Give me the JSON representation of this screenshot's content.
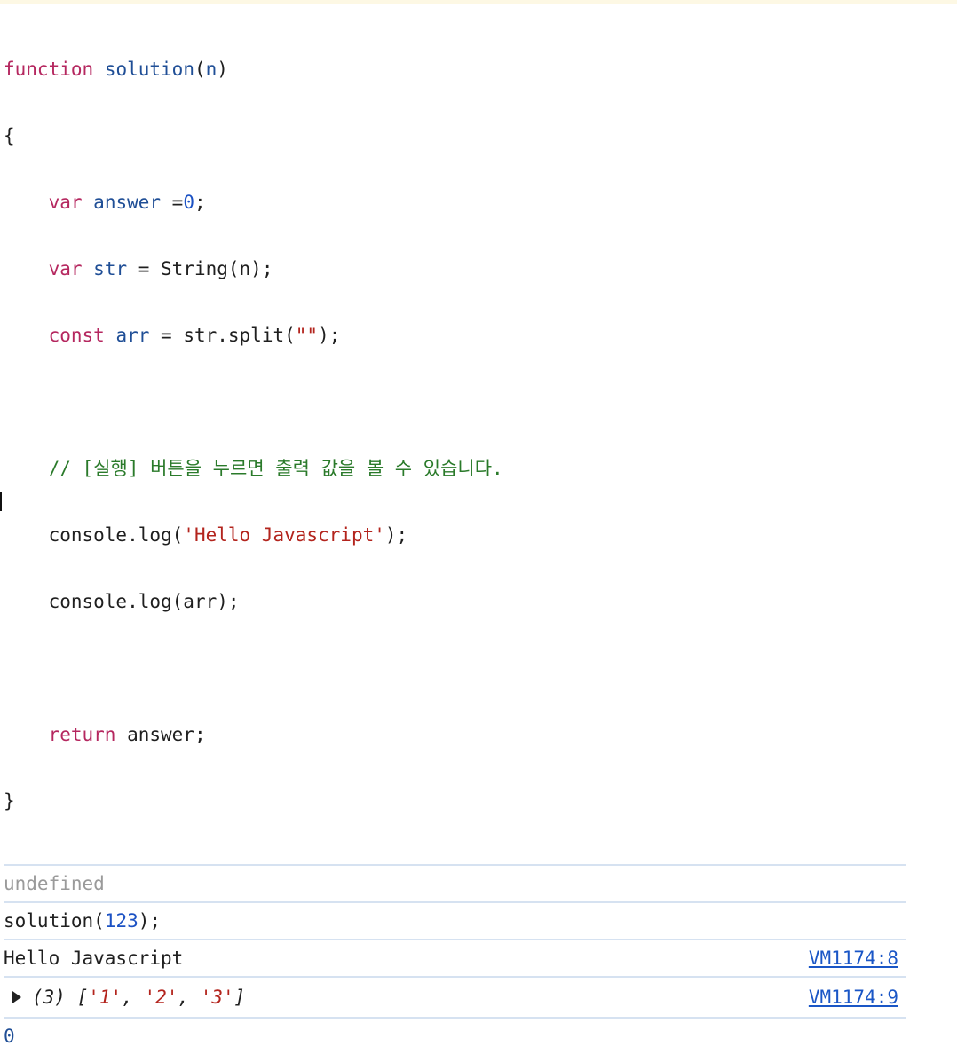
{
  "code": {
    "line1": {
      "kw": "function",
      "name": "solution",
      "open": "(",
      "param": "n",
      "close": ")"
    },
    "line2": "{",
    "line3": {
      "indent": "    ",
      "kw": "var",
      "name": "answer",
      "op": " =",
      "val": "0",
      "end": ";"
    },
    "line4": {
      "indent": "    ",
      "kw": "var",
      "name": "str",
      "rest": " = String(n);"
    },
    "line5": {
      "indent": "    ",
      "kw": "const",
      "name": "arr",
      "mid": " = str.split(",
      "str": "\"\"",
      "end": ");"
    },
    "line6": "",
    "line7": {
      "indent": "    ",
      "comment": "// [실행] 버튼을 누르면 출력 값을 볼 수 있습니다."
    },
    "line8": {
      "indent": "    ",
      "pre": "console.log(",
      "str": "'Hello Javascript'",
      "end": ");"
    },
    "line9": {
      "indent": "    ",
      "text": "console.log(arr);"
    },
    "line10": "",
    "line11": {
      "indent": "    ",
      "kw": "return",
      "rest": " answer;"
    },
    "line12": "}"
  },
  "output": {
    "undefined_text": "undefined",
    "input_call": {
      "pre": "solution(",
      "num": "123",
      "end": ");"
    },
    "log1": {
      "text": "Hello Javascript",
      "source": "VM1174:8"
    },
    "log2": {
      "count": "(3)",
      "open": " [",
      "items": [
        "'1'",
        "'2'",
        "'3'"
      ],
      "sep": ", ",
      "close": "]",
      "source": "VM1174:9"
    },
    "return_value": "0"
  },
  "colors": {
    "keyword": "#b5275f",
    "identifier": "#1f4e96",
    "number": "#1c52c4",
    "string": "#b3241d",
    "comment": "#2a7a2a",
    "link": "#1a56c6",
    "divider": "#d6e2f1"
  }
}
